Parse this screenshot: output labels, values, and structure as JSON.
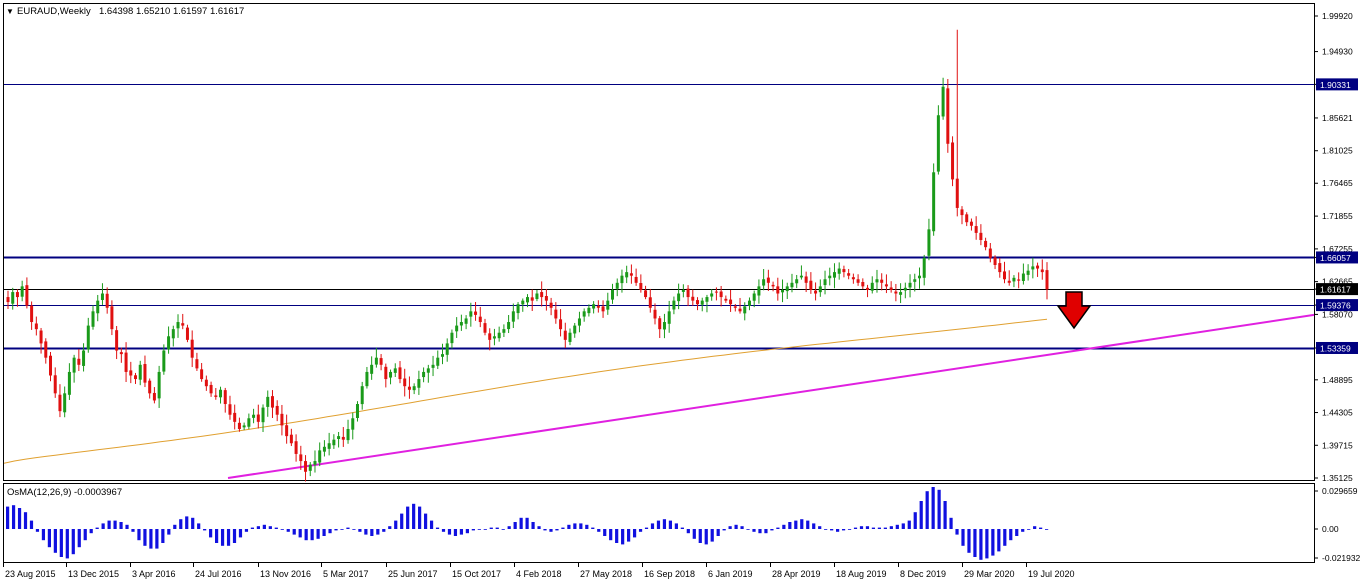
{
  "header": {
    "menu_glyph": "▼",
    "symbol": "EURAUD,Weekly",
    "ohlc": "1.64398 1.65210 1.61597 1.61617"
  },
  "oscillator": {
    "label": "OsMA(12,26,9) -0.0003967",
    "scale_labels": [
      "0.029659",
      "0.00",
      "-0.021932"
    ],
    "histogram": [
      0.016,
      0.017,
      0.015,
      0.012,
      0.006,
      -0.002,
      -0.008,
      -0.013,
      -0.017,
      -0.02,
      -0.021,
      -0.018,
      -0.013,
      -0.008,
      -0.003,
      0.001,
      0.004,
      0.006,
      0.006,
      0.005,
      0.003,
      -0.002,
      -0.008,
      -0.012,
      -0.014,
      -0.014,
      -0.01,
      -0.004,
      0.003,
      0.007,
      0.009,
      0.008,
      0.004,
      -0.001,
      -0.006,
      -0.01,
      -0.012,
      -0.012,
      -0.01,
      -0.006,
      -0.002,
      0.001,
      0.002,
      0.003,
      0.002,
      0.001,
      0.0,
      -0.002,
      -0.004,
      -0.006,
      -0.008,
      -0.008,
      -0.007,
      -0.005,
      -0.003,
      -0.001,
      0.0,
      0.001,
      0.0,
      -0.002,
      -0.004,
      -0.005,
      -0.004,
      -0.002,
      0.002,
      0.006,
      0.011,
      0.016,
      0.018,
      0.016,
      0.011,
      0.006,
      0.001,
      -0.002,
      -0.004,
      -0.005,
      -0.004,
      -0.003,
      -0.001,
      0.0,
      0.0,
      0.001,
      0.001,
      0.0,
      0.002,
      0.005,
      0.008,
      0.008,
      0.005,
      0.002,
      -0.001,
      -0.002,
      -0.001,
      0.001,
      0.003,
      0.004,
      0.004,
      0.003,
      0.001,
      -0.002,
      -0.005,
      -0.008,
      -0.01,
      -0.011,
      -0.009,
      -0.006,
      -0.002,
      0.001,
      0.004,
      0.006,
      0.007,
      0.006,
      0.004,
      0.001,
      -0.003,
      -0.007,
      -0.01,
      -0.011,
      -0.009,
      -0.005,
      -0.001,
      0.002,
      0.003,
      0.002,
      0.0,
      -0.002,
      -0.003,
      -0.003,
      -0.001,
      0.001,
      0.003,
      0.005,
      0.006,
      0.007,
      0.006,
      0.004,
      0.002,
      0.0,
      -0.001,
      -0.002,
      -0.001,
      0.0,
      0.001,
      0.002,
      0.002,
      0.001,
      0.001,
      0.001,
      0.002,
      0.003,
      0.004,
      0.006,
      0.012,
      0.02,
      0.027,
      0.03,
      0.028,
      0.02,
      0.008,
      -0.004,
      -0.012,
      -0.017,
      -0.02,
      -0.022,
      -0.021,
      -0.019,
      -0.016,
      -0.012,
      -0.008,
      -0.005,
      -0.002,
      0.0,
      0.002,
      0.001,
      0.0
    ]
  },
  "price_scale": [
    "1.99920",
    "1.94930",
    "1.90331",
    "1.85621",
    "1.81025",
    "1.76465",
    "1.71855",
    "1.67255",
    "1.66057",
    "1.62665",
    "1.61617",
    "1.59376",
    "1.58070",
    "1.53359",
    "1.48895",
    "1.44305",
    "1.39715",
    "1.35125"
  ],
  "level_tags": [
    {
      "price": 1.90331,
      "label": "1.90331",
      "style": "navy"
    },
    {
      "price": 1.66057,
      "label": "1.66057",
      "style": "navy"
    },
    {
      "price": 1.61617,
      "label": "1.61617",
      "style": "black"
    },
    {
      "price": 1.59376,
      "label": "1.59376",
      "style": "navy"
    },
    {
      "price": 1.53359,
      "label": "1.53359",
      "style": "navy"
    }
  ],
  "time_axis": [
    "23 Aug 2015",
    "13 Dec 2015",
    "3 Apr 2016",
    "24 Jul 2016",
    "13 Nov 2016",
    "5 Mar 2017",
    "25 Jun 2017",
    "15 Oct 2017",
    "4 Feb 2018",
    "27 May 2018",
    "16 Sep 2018",
    "6 Jan 2019",
    "28 Apr 2019",
    "18 Aug 2019",
    "8 Dec 2019",
    "29 Mar 2020",
    "19 Jul 2020"
  ],
  "colors": {
    "bull": "#1a9a1a",
    "bear": "#e01010",
    "level": "#000080",
    "ma": "#e0a030",
    "trend": "#e020e0",
    "arrow": "#e00000",
    "hist": "#1010e0"
  },
  "chart_data": {
    "type": "candlestick",
    "title": "EURAUD,Weekly",
    "ylim": [
      1.35125,
      1.9992
    ],
    "horizontal_levels": [
      1.90331,
      1.66057,
      1.61617,
      1.59376,
      1.53359
    ],
    "moving_average": {
      "start": 1.372,
      "end": 1.574
    },
    "trendline": {
      "start": 1.35125,
      "end": 1.58
    },
    "signal": "down-arrow",
    "closes": [
      1.598,
      1.612,
      1.605,
      1.62,
      1.593,
      1.57,
      1.56,
      1.54,
      1.52,
      1.495,
      1.47,
      1.445,
      1.47,
      1.5,
      1.52,
      1.51,
      1.53,
      1.565,
      1.585,
      1.6,
      1.61,
      1.59,
      1.56,
      1.53,
      1.525,
      1.5,
      1.495,
      1.49,
      1.51,
      1.485,
      1.47,
      1.46,
      1.5,
      1.53,
      1.55,
      1.56,
      1.57,
      1.565,
      1.545,
      1.52,
      1.505,
      1.49,
      1.48,
      1.47,
      1.465,
      1.475,
      1.455,
      1.44,
      1.43,
      1.42,
      1.425,
      1.435,
      1.44,
      1.43,
      1.45,
      1.465,
      1.45,
      1.44,
      1.425,
      1.41,
      1.4,
      1.385,
      1.375,
      1.36,
      1.37,
      1.375,
      1.39,
      1.395,
      1.4,
      1.405,
      1.41,
      1.405,
      1.42,
      1.435,
      1.455,
      1.48,
      1.5,
      1.51,
      1.52,
      1.51,
      1.49,
      1.5,
      1.505,
      1.49,
      1.48,
      1.475,
      1.48,
      1.49,
      1.5,
      1.505,
      1.51,
      1.52,
      1.525,
      1.54,
      1.555,
      1.565,
      1.57,
      1.575,
      1.585,
      1.58,
      1.57,
      1.555,
      1.545,
      1.55,
      1.555,
      1.56,
      1.57,
      1.585,
      1.595,
      1.6,
      1.605,
      1.6,
      1.61,
      1.605,
      1.6,
      1.59,
      1.575,
      1.56,
      1.545,
      1.555,
      1.565,
      1.575,
      1.585,
      1.59,
      1.595,
      1.59,
      1.585,
      1.6,
      1.615,
      1.625,
      1.635,
      1.64,
      1.635,
      1.625,
      1.615,
      1.605,
      1.59,
      1.575,
      1.56,
      1.57,
      1.585,
      1.6,
      1.61,
      1.615,
      1.605,
      1.6,
      1.595,
      1.6,
      1.605,
      1.61,
      1.612,
      1.605,
      1.6,
      1.595,
      1.59,
      1.585,
      1.592,
      1.6,
      1.61,
      1.62,
      1.63,
      1.625,
      1.62,
      1.61,
      1.615,
      1.62,
      1.625,
      1.63,
      1.635,
      1.625,
      1.615,
      1.61,
      1.62,
      1.63,
      1.635,
      1.64,
      1.645,
      1.64,
      1.635,
      1.63,
      1.625,
      1.62,
      1.615,
      1.625,
      1.63,
      1.625,
      1.62,
      1.615,
      1.61,
      1.612,
      1.618,
      1.625,
      1.63,
      1.635,
      1.66,
      1.7,
      1.78,
      1.86,
      1.9,
      1.82,
      1.77,
      1.73,
      1.72,
      1.71,
      1.705,
      1.695,
      1.685,
      1.675,
      1.66,
      1.65,
      1.64,
      1.63,
      1.625,
      1.632,
      1.628,
      1.638,
      1.642,
      1.648,
      1.645,
      1.64,
      1.616
    ],
    "osma": "see oscillator.histogram"
  }
}
